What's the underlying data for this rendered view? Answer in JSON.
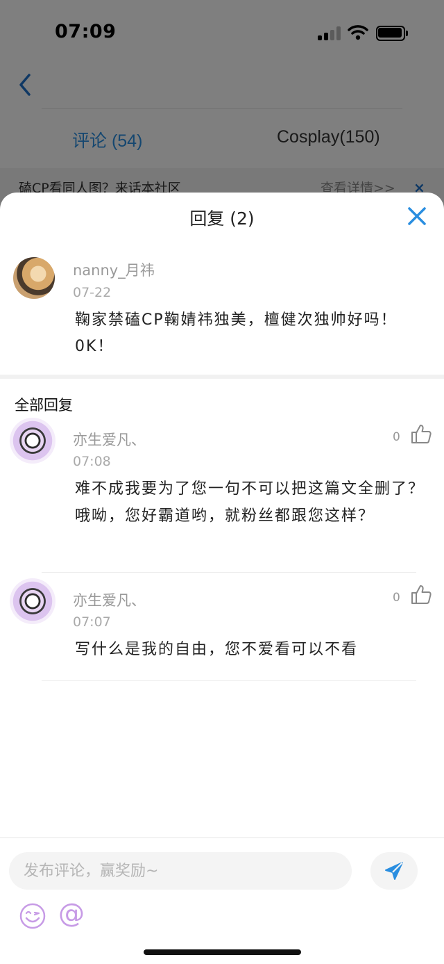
{
  "status_bar": {
    "time": "07:09"
  },
  "header": {
    "tabs": [
      {
        "label": "评论 (54)",
        "active": true
      },
      {
        "label": "Cosplay(150)",
        "active": false
      }
    ]
  },
  "banner": {
    "text": "磕CP看同人图？来话本社区",
    "link": "查看详情>>",
    "close": "×"
  },
  "sheet": {
    "title": "回复 (2)",
    "original_comment": {
      "username": "nanny_月祎",
      "date": "07-22",
      "text": "鞠家禁磕CP鞠婧祎独美，檀健次独帅好吗！0K！"
    },
    "section_title": "全部回复",
    "replies": [
      {
        "username": "亦生爱凡、",
        "date": "07:08",
        "likes": "0",
        "text": "难不成我要为了您一句不可以把这篇文全删了？哦呦，您好霸道哟，就粉丝都跟您这样？"
      },
      {
        "username": "亦生爱凡、",
        "date": "07:07",
        "likes": "0",
        "text": "写什么是我的自由，您不爱看可以不看"
      }
    ]
  },
  "composer": {
    "placeholder": "发布评论，赢奖励~",
    "at_symbol": "@"
  },
  "colors": {
    "accent_blue": "#2a8ee0",
    "emoji_purple": "#c79be6"
  }
}
